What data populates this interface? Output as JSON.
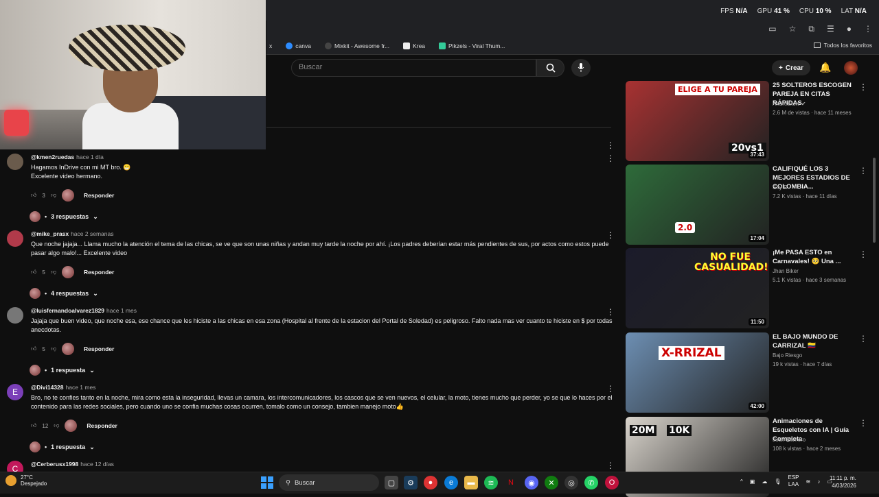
{
  "overlay": {
    "fps_label": "FPS",
    "fps_value": "N/A",
    "gpu_label": "GPU",
    "gpu_value": "41 %",
    "cpu_label": "CPU",
    "cpu_value": "10 %",
    "lat_label": "LAT",
    "lat_value": "N/A"
  },
  "bookmarks": [
    {
      "label": "x",
      "color": "#202124"
    },
    {
      "label": "canva",
      "color": "#2d8cff"
    },
    {
      "label": "Mixkit - Awesome fr...",
      "color": "#444"
    },
    {
      "label": "Krea",
      "color": "#fff"
    },
    {
      "label": "Pikzels - Viral Thum...",
      "color": "#3c9"
    }
  ],
  "favorites_label": "Todos los favoritos",
  "search": {
    "placeholder": "Buscar"
  },
  "header": {
    "create_label": "Crear"
  },
  "comments": [
    {
      "avatar_letter": "",
      "avatar_color": "#6a5b4c",
      "user": "@kmen2ruedas",
      "time": "hace 1 día",
      "text": "Hagamos InDrive con mi MT bro. 😁\nExcelente video hermano.",
      "likes": "3",
      "reply_label": "Responder",
      "replies": "3 respuestas"
    },
    {
      "avatar_letter": "",
      "avatar_color": "#b13a4a",
      "user": "@mike_prasx",
      "time": "hace 2 semanas",
      "text": "Que noche jajaja... Llama mucho la atención el tema de las chicas, se ve que son unas niñas y andan muy tarde la noche por ahí. ¡Los padres deberían estar más pendientes de sus, por actos como estos puede pasar algo malo!... Excelente video",
      "likes": "5",
      "reply_label": "Responder",
      "replies": "4 respuestas"
    },
    {
      "avatar_letter": "",
      "avatar_color": "#777",
      "user": "@luisfernandoalvarez1829",
      "time": "hace 1 mes",
      "text": "Jajaja que buen video, que noche esa, ese chance que les hiciste a las chicas en esa zona (Hospital al frente de la estacion del Portal de Soledad) es peligroso. Falto nada mas ver cuanto te hiciste en $ por todas anecdotas.",
      "likes": "5",
      "reply_label": "Responder",
      "replies": "1 respuesta"
    },
    {
      "avatar_letter": "E",
      "avatar_color": "#7b3fb8",
      "user": "@Divi14328",
      "time": "hace 1 mes",
      "text": "Bro, no te confies tanto en la noche, mira como esta la inseguridad, llevas un camara, los intercomunicadores, los cascos que se ven nuevos, el celular, la moto, tienes mucho que perder, yo se que lo haces por el contenido para las redes sociales, pero cuando uno se confia muchas cosas ocurren, tomalo como un consejo, tambien manejo moto👍",
      "likes": "12",
      "reply_label": "Responder",
      "replies": "1 respuesta"
    },
    {
      "avatar_letter": "C",
      "avatar_color": "#c2185b",
      "user": "@Cerberusx1998",
      "time": "hace 12 días",
      "text": "",
      "likes": "",
      "reply_label": "",
      "replies": ""
    }
  ],
  "recommendations": [
    {
      "title": "25 SOLTEROS ESCOGEN PAREJA EN CITAS RÁPIDAS",
      "channel": "Andresitow ✔",
      "meta": "2.6 M de vistas · hace 11 meses",
      "duration": "37:43",
      "thumb_text": "ELIGE A TU PAREJA",
      "thumb_text2": "20vs1",
      "bg": "#a83232"
    },
    {
      "title": "CALIFIQUÉ LOS 3 MEJORES ESTADIOS DE COLOMBIA...",
      "channel": "Soy R",
      "meta": "7.2 K vistas · hace 11 días",
      "duration": "17:04",
      "thumb_text": "2.0",
      "thumb_text2": "",
      "bg": "#2e6b3a"
    },
    {
      "title": "¡Me PASA ESTO en Carnavales! 🥺 Una ...",
      "channel": "Jhan Biker",
      "meta": "5.1 K vistas · hace 3 semanas",
      "duration": "11:50",
      "thumb_text": "NO FUE CASUALIDAD!!",
      "thumb_text2": "",
      "bg": "#1b1b2a"
    },
    {
      "title": "EL BAJO MUNDO DE CARRIZAL 🇨🇴",
      "channel": "Bajo Riesgo",
      "meta": "19 k vistas · hace 7 días",
      "duration": "42:00",
      "thumb_text": "X-RRIZAL",
      "thumb_text2": "",
      "bg": "#6d8fb3"
    },
    {
      "title": "Animaciones de Esqueletos con IA | Guía Completa",
      "channel": "Juan Romero",
      "meta": "108 k vistas · hace 2 meses",
      "duration": "",
      "thumb_text": "20M",
      "thumb_text2": "10K",
      "bg": "#d9d4cc"
    }
  ],
  "taskbar": {
    "temp": "27°C",
    "weather": "Despejado",
    "search": "Buscar",
    "lang": "ESP",
    "lang2": "LAA",
    "time": "11:11 p. m.",
    "date": "4/03/2026"
  }
}
